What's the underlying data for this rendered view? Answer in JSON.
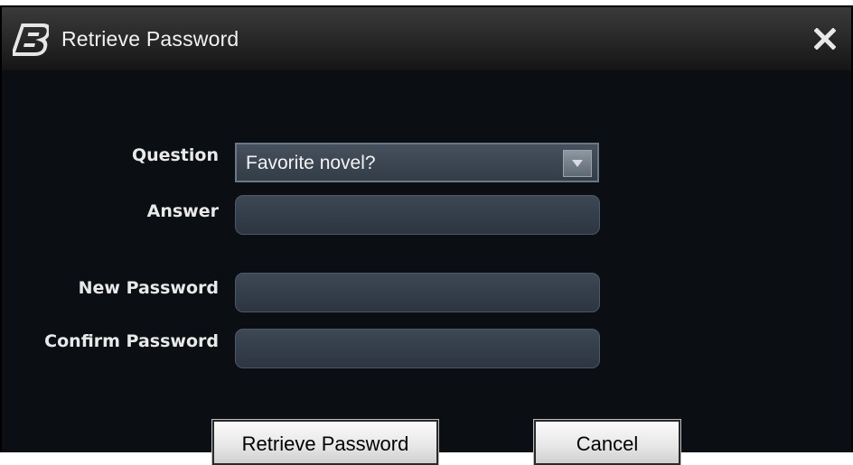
{
  "window": {
    "title": "Retrieve Password",
    "logo_icon": "b-logo-icon",
    "close_icon": "close-icon"
  },
  "form": {
    "question_label": "Question",
    "question_value": "Favorite novel?",
    "answer_label": "Answer",
    "answer_value": "",
    "new_password_label": "New Password",
    "new_password_value": "",
    "confirm_password_label": "Confirm Password",
    "confirm_password_value": ""
  },
  "buttons": {
    "retrieve_label": "Retrieve Password",
    "cancel_label": "Cancel"
  },
  "colors": {
    "background": "#0b0f13",
    "field": "#36414d",
    "text": "#e9e9e9"
  }
}
